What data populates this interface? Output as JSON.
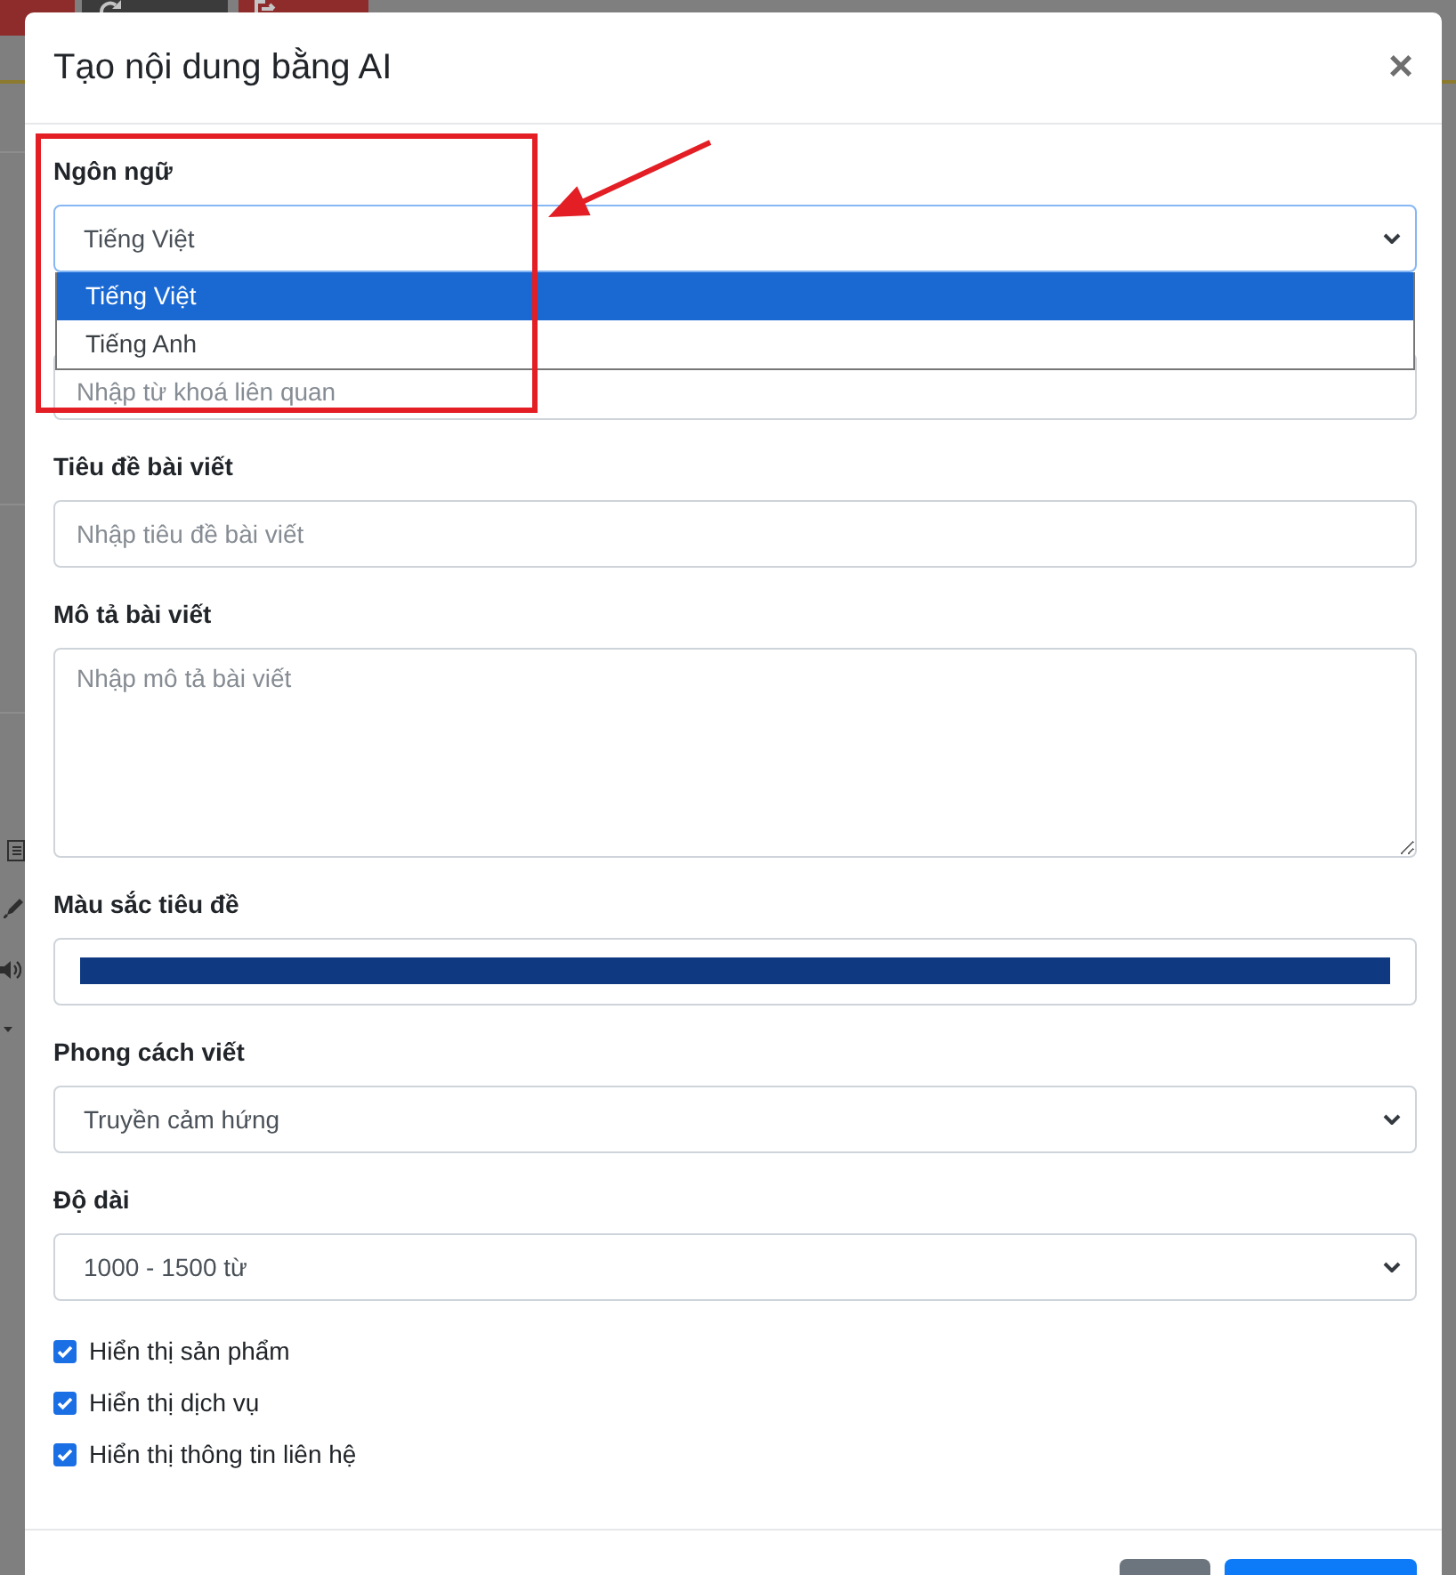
{
  "background": {
    "toolbar": [
      {
        "kind": "ai"
      },
      {
        "kind": "reset"
      },
      {
        "kind": "exit"
      }
    ]
  },
  "modal": {
    "title": "Tạo nội dung bằng AI",
    "close": "×"
  },
  "language": {
    "label": "Ngôn ngữ",
    "value": "Tiếng Việt",
    "expanded": true,
    "options": [
      {
        "label": "Tiếng Việt",
        "selected": true
      },
      {
        "label": "Tiếng Anh",
        "selected": false
      }
    ]
  },
  "keywords": {
    "placeholder": "Nhập từ khoá liên quan"
  },
  "article_title": {
    "label": "Tiêu đề bài viết",
    "placeholder": "Nhập tiêu đề bài viết"
  },
  "description": {
    "label": "Mô tả bài viết",
    "placeholder": "Nhập mô tả bài viết"
  },
  "title_color": {
    "label": "Màu sắc tiêu đề",
    "color": "#0f3a82"
  },
  "writing_style": {
    "label": "Phong cách viết",
    "value": "Truyền cảm hứng"
  },
  "length": {
    "label": "Độ dài",
    "value": "1000 - 1500 từ"
  },
  "display_options": [
    {
      "label": "Hiển thị sản phẩm",
      "checked": true
    },
    {
      "label": "Hiển thị dịch vụ",
      "checked": true
    },
    {
      "label": "Hiển thị thông tin liên hệ",
      "checked": true
    }
  ],
  "footer": {
    "buttons": [
      {
        "kind": "secondary"
      },
      {
        "kind": "primary"
      }
    ]
  }
}
